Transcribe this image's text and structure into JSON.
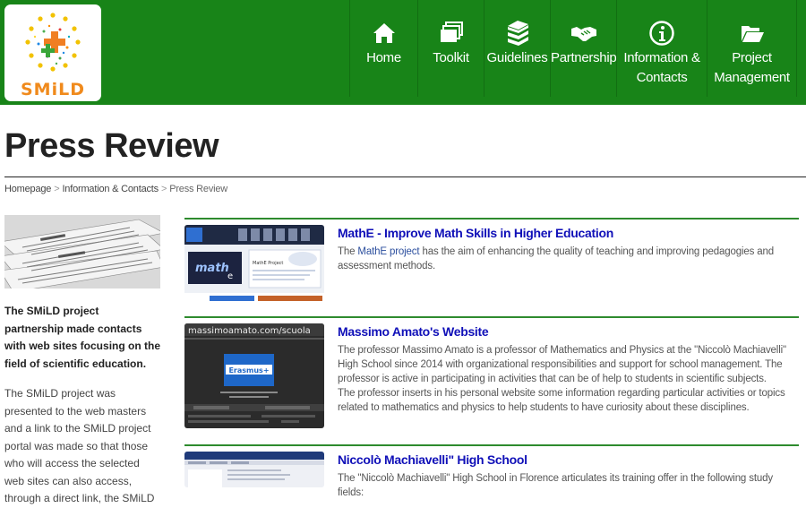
{
  "header": {
    "logo_text": "SMiLD",
    "nav": [
      {
        "label": "Home",
        "icon": "home-icon"
      },
      {
        "label": "Toolkit",
        "icon": "windows-stack-icon"
      },
      {
        "label": "Guidelines",
        "icon": "books-icon"
      },
      {
        "label": "Partnership",
        "icon": "handshake-icon"
      },
      {
        "label": "Information &",
        "label2": "Contacts",
        "icon": "info-icon"
      },
      {
        "label": "Project",
        "label2": "Management",
        "icon": "folder-open-icon"
      }
    ],
    "colors": {
      "bar": "#188418",
      "title_link": "#1010b8",
      "rule": "#2e8b2e"
    }
  },
  "page": {
    "title": "Press Review",
    "breadcrumb": [
      "Homepage",
      "Information & Contacts",
      "Press Review"
    ]
  },
  "sidebar": {
    "lead": "The SMiLD project partnership made contacts with web sites focusing on the field of scientific education.",
    "text": "The SMiLD project was presented to the web masters and a link to the SMiLD project portal was made so that those who will access the selected web sites can also access, through a direct link, the SMiLD"
  },
  "articles": [
    {
      "title": "MathE - Improve Math Skills in Higher Education",
      "body_pre": "The ",
      "body_link": "MathE project",
      "body_post": " has the aim of enhancing the quality of teaching and improving pedagogies and assessment methods.",
      "thumb_text": "MathE Project"
    },
    {
      "title": "Massimo Amato's Website",
      "body1": "The professor Massimo Amato is a professor of Mathematics and Physics at the \"Niccolò Machiavelli\" High School since 2014 with organizational responsibilities and support for school management. The professor is active in participating in activities that can be of help to students in scientific subjects.",
      "body2": "The professor inserts in his personal website some information regarding particular activities or topics related to mathematics and physics to help students to have curiosity about these disciplines.",
      "thumb_text": "massimoamato.com/scuola",
      "thumb_badge": "Erasmus+"
    },
    {
      "title": "Niccolò Machiavelli\" High School",
      "body1": "The \"Niccolò Machiavelli\" High School in Florence articulates its training offer in the following study fields:"
    }
  ]
}
